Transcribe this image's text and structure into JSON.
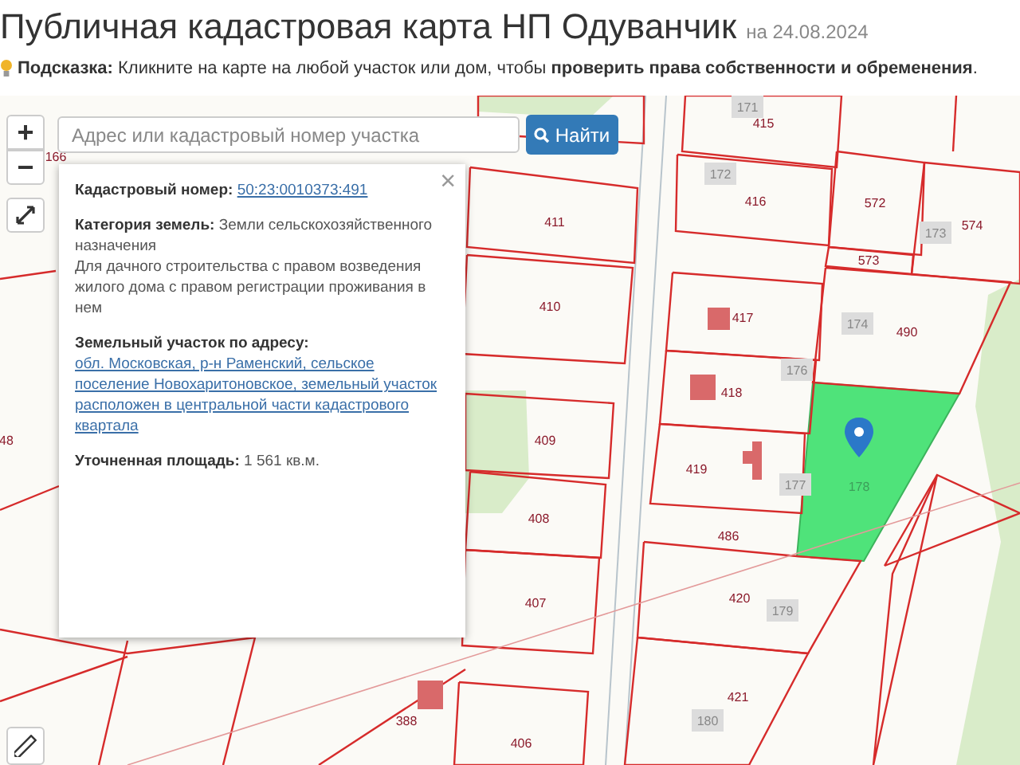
{
  "header": {
    "title": "Публичная кадастровая карта НП Одуванчик",
    "date": "на 24.08.2024"
  },
  "hint": "**Подсказка:** Кликните на карте на любой участок или дом, чтобы **проверить права собственности и обременения**.",
  "search": {
    "placeholder": "Адрес или кадастровый номер участка",
    "button": "Найти"
  },
  "map_controls": {
    "zoom_in": "+",
    "zoom_out": "−"
  },
  "popup": {
    "close": "×",
    "fields": [
      {
        "kind": "link",
        "label": "Кадастровый номер:",
        "value": "50:23:0010373:491"
      },
      {
        "kind": "text",
        "label": "Категория земель:",
        "value": "Земли сельскохозяйственного назначения",
        "note": "Для дачного строительства с правом возведения жилого дома с правом регистрации проживания в нем"
      },
      {
        "kind": "link",
        "label": "Земельный участок по адресу:",
        "value": "обл. Московская, р-н Раменский, сельское поселение Новохаритоновское, земельный участок расположен в центральной части кадастрового квартала"
      },
      {
        "kind": "text",
        "label": "Уточненная площадь:",
        "value": "1 561 кв.м."
      }
    ]
  },
  "map_labels": [
    {
      "kind": "building",
      "text": "171"
    },
    {
      "kind": "parcel",
      "text": "415"
    },
    {
      "kind": "building",
      "text": "172"
    },
    {
      "kind": "parcel",
      "text": "416"
    },
    {
      "kind": "parcel",
      "text": "572"
    },
    {
      "kind": "building",
      "text": "173"
    },
    {
      "kind": "parcel",
      "text": "574"
    },
    {
      "kind": "parcel",
      "text": "573"
    },
    {
      "kind": "parcel",
      "text": "411"
    },
    {
      "kind": "parcel",
      "text": "410"
    },
    {
      "kind": "parcel",
      "text": "417"
    },
    {
      "kind": "building",
      "text": "174"
    },
    {
      "kind": "parcel",
      "text": "490"
    },
    {
      "kind": "building",
      "text": "176"
    },
    {
      "kind": "parcel",
      "text": "418"
    },
    {
      "kind": "parcel",
      "text": "409"
    },
    {
      "kind": "parcel",
      "text": "419"
    },
    {
      "kind": "building",
      "text": "177"
    },
    {
      "kind": "selected",
      "text": "178"
    },
    {
      "kind": "parcel",
      "text": "408"
    },
    {
      "kind": "parcel",
      "text": "486"
    },
    {
      "kind": "parcel",
      "text": "407"
    },
    {
      "kind": "parcel",
      "text": "420"
    },
    {
      "kind": "building",
      "text": "179"
    },
    {
      "kind": "parcel",
      "text": "421"
    },
    {
      "kind": "building",
      "text": "180"
    },
    {
      "kind": "parcel",
      "text": "406"
    },
    {
      "kind": "parcel",
      "text": "388"
    },
    {
      "kind": "parcel",
      "text": "48"
    },
    {
      "kind": "parcel",
      "text": "166"
    }
  ]
}
